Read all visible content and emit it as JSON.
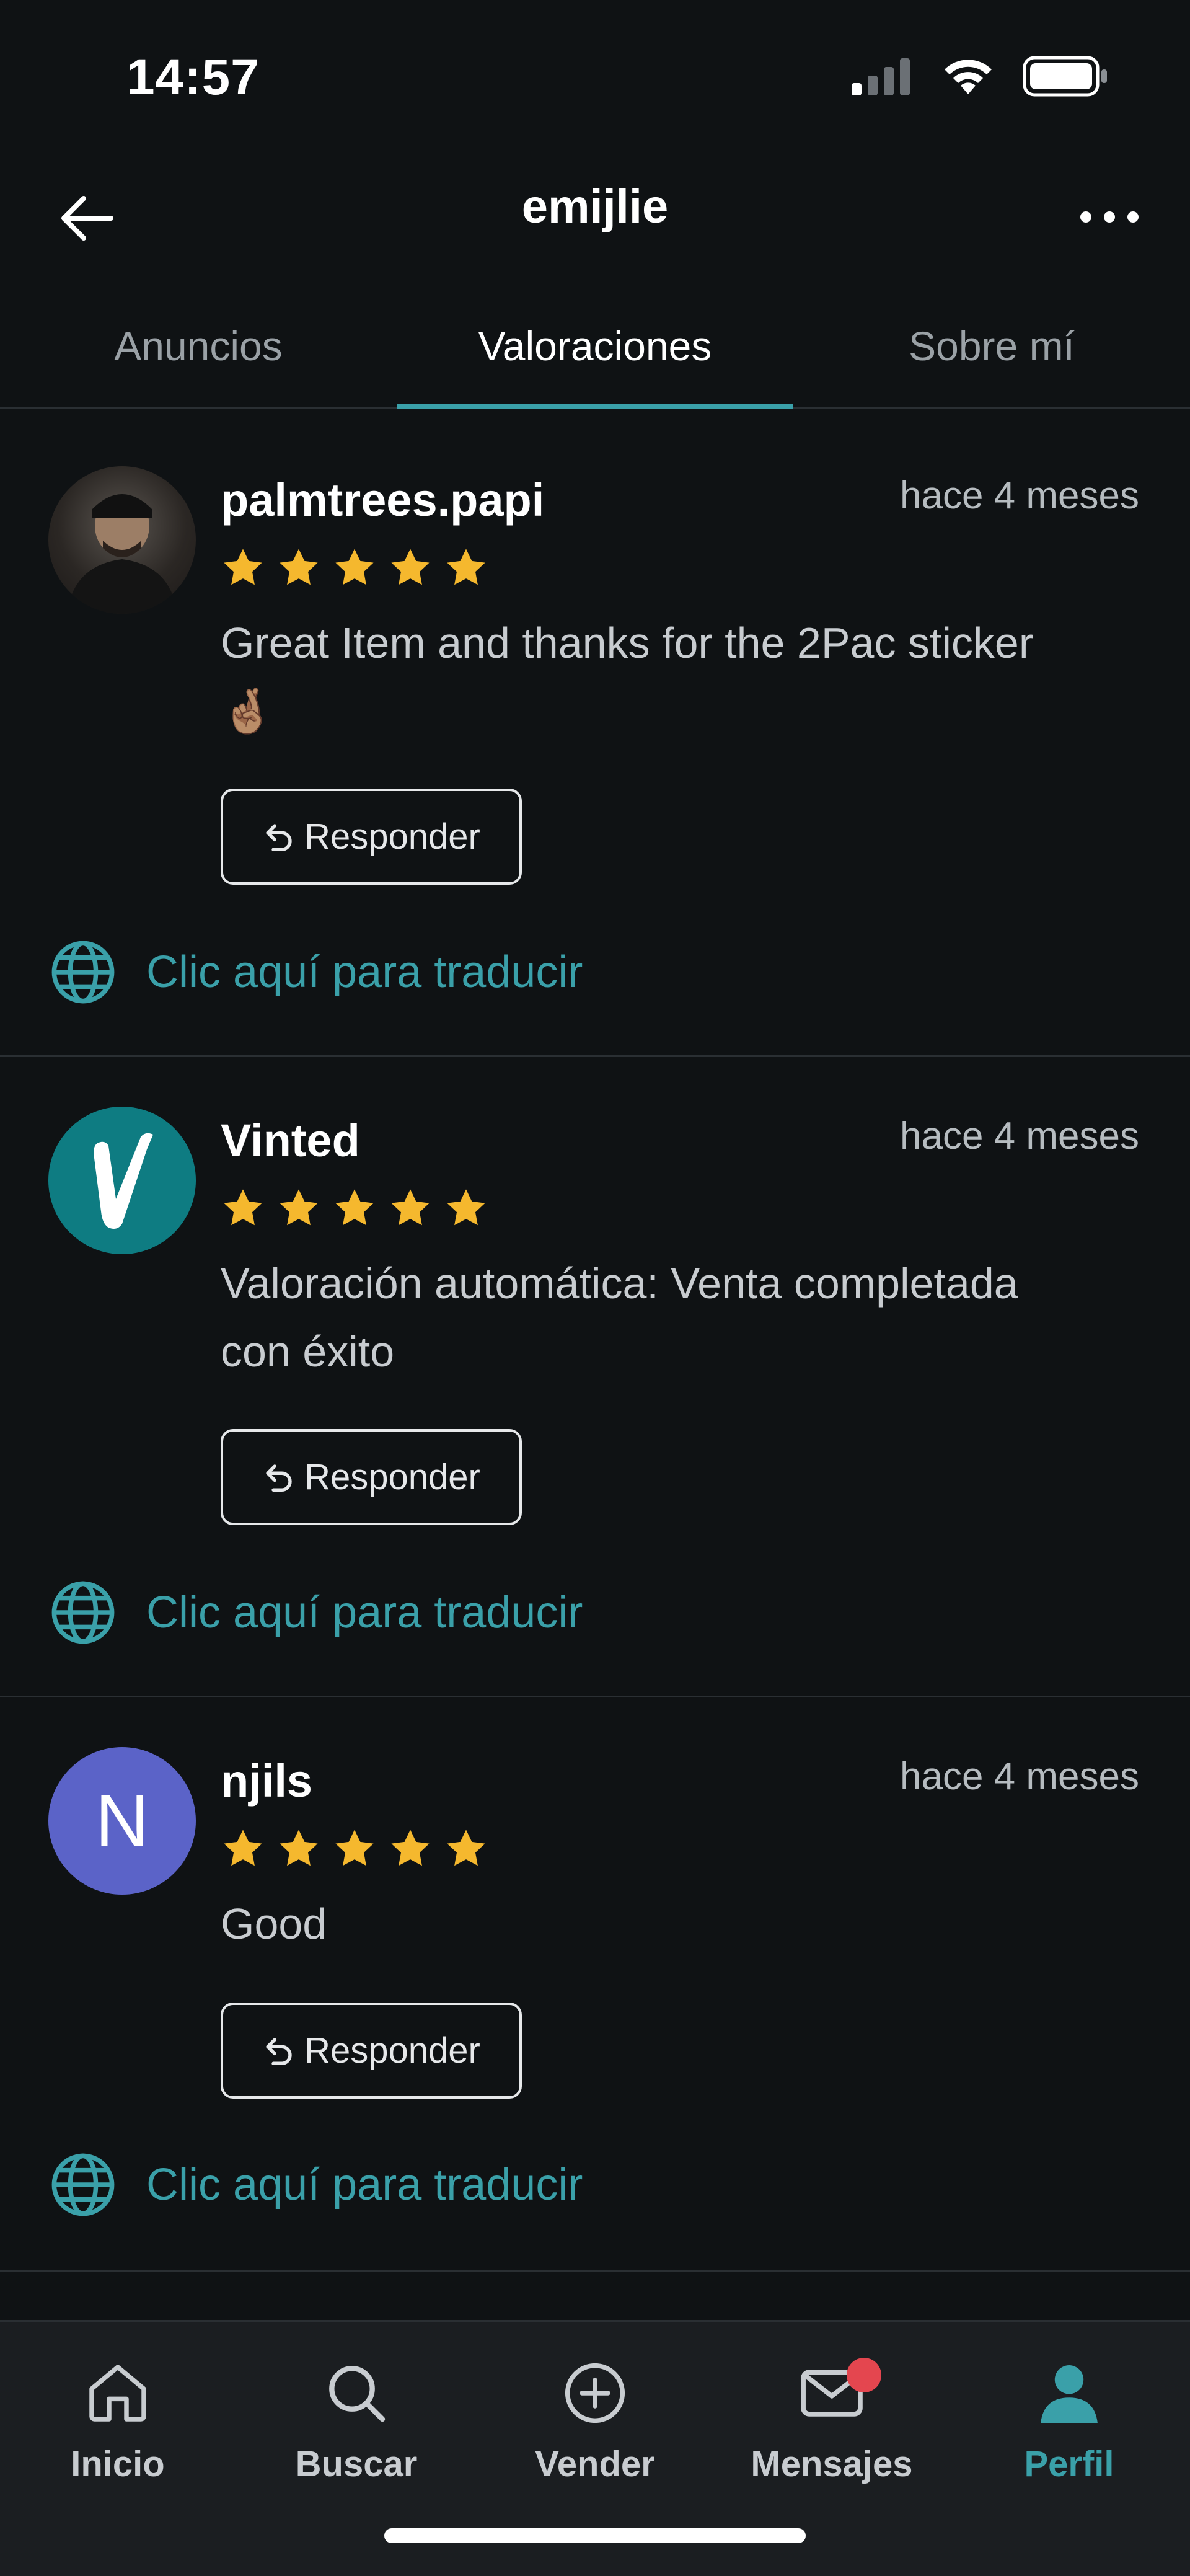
{
  "status_bar": {
    "time": "14:57"
  },
  "header": {
    "title": "emijlie"
  },
  "tabs": [
    {
      "label": "Anuncios",
      "active": false
    },
    {
      "label": "Valoraciones",
      "active": true
    },
    {
      "label": "Sobre mí",
      "active": false
    }
  ],
  "reviews": [
    {
      "username": "palmtrees.papi",
      "time": "hace 4 meses",
      "rating": 5,
      "comment": "Great Item and thanks for the 2Pac sticker 🤞🏽",
      "reply_label": "Responder",
      "translate_label": "Clic aquí para traducir"
    },
    {
      "username": "Vinted",
      "time": "hace 4 meses",
      "rating": 5,
      "comment": "Valoración automática: Venta completada con éxito",
      "reply_label": "Responder",
      "translate_label": "Clic aquí para traducir"
    },
    {
      "username": "njils",
      "avatar_letter": "N",
      "time": "hace 4 meses",
      "rating": 5,
      "comment": "Good",
      "reply_label": "Responder",
      "translate_label": "Clic aquí para traducir"
    }
  ],
  "bottom_nav": [
    {
      "label": "Inicio",
      "icon": "home-icon",
      "active": false
    },
    {
      "label": "Buscar",
      "icon": "search-icon",
      "active": false
    },
    {
      "label": "Vender",
      "icon": "plus-circle-icon",
      "active": false
    },
    {
      "label": "Mensajes",
      "icon": "mail-icon",
      "active": false,
      "badge": true
    },
    {
      "label": "Perfil",
      "icon": "profile-icon",
      "active": true
    }
  ],
  "colors": {
    "background": "#0f1214",
    "accent": "#3aa0a9",
    "star": "#f5b82e",
    "badge": "#e4464f"
  }
}
